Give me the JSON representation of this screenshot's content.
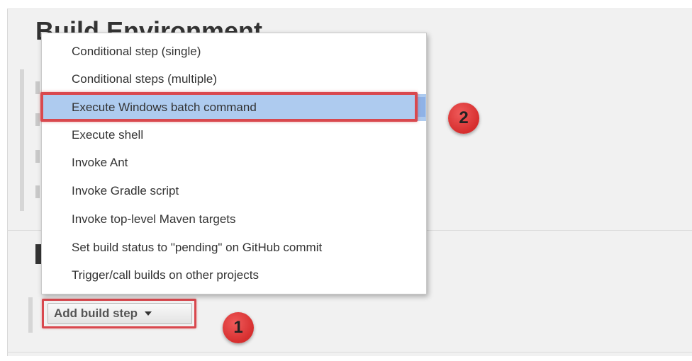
{
  "section": {
    "title": "Build Environment"
  },
  "dropdown": {
    "items": [
      {
        "label": "Conditional step (single)"
      },
      {
        "label": "Conditional steps (multiple)"
      },
      {
        "label": "Execute Windows batch command",
        "highlighted": true
      },
      {
        "label": "Execute shell"
      },
      {
        "label": "Invoke Ant"
      },
      {
        "label": "Invoke Gradle script"
      },
      {
        "label": "Invoke top-level Maven targets"
      },
      {
        "label": "Set build status to \"pending\" on GitHub commit"
      },
      {
        "label": "Trigger/call builds on other projects"
      }
    ]
  },
  "add_build_step": {
    "label": "Add build step",
    "icon": "caret-down-icon"
  },
  "annotations": {
    "step1": "1",
    "step2": "2"
  },
  "colors": {
    "highlight": "#aecbef",
    "annotation_red": "#d9484e",
    "panel_bg": "#f1f1f1"
  }
}
